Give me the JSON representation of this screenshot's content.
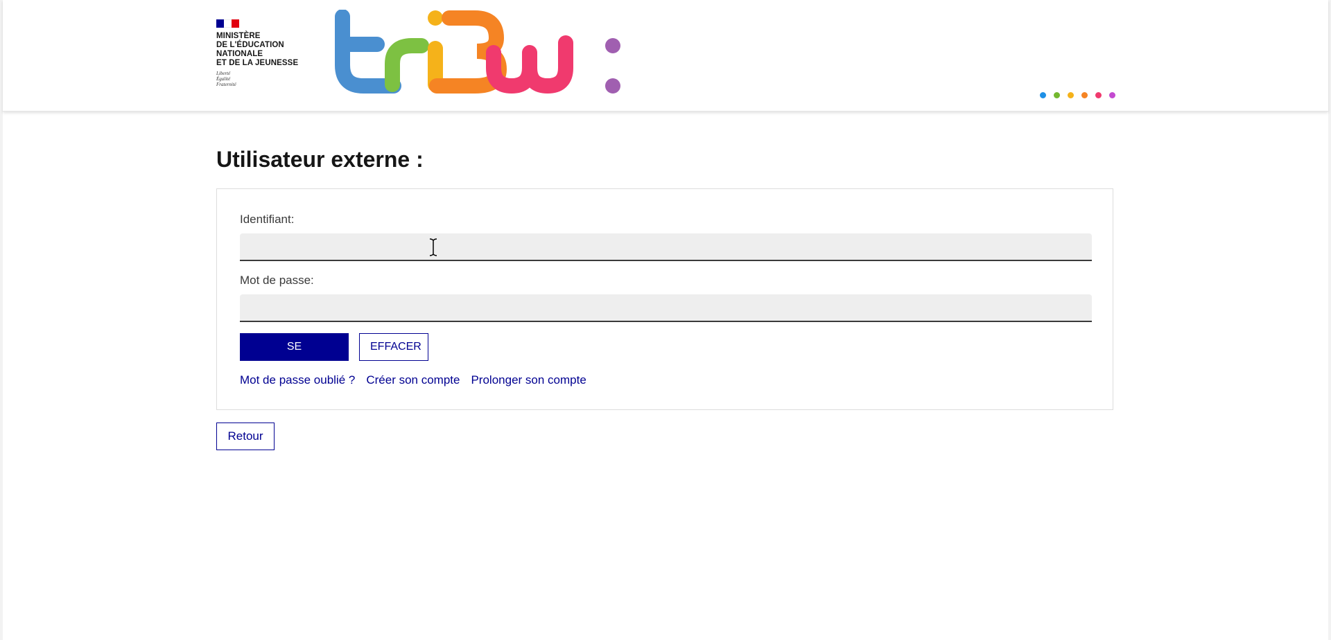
{
  "header": {
    "ministry_lines": "Ministère\nde l'Éducation\nnationale\net de la Jeunesse",
    "ministry_motto": "Liberté\nÉgalité\nFraternité",
    "brand_logo_icon": "tribu-logo",
    "colors": {
      "blue": "#4a8fd0",
      "green": "#7dc142",
      "yellow": "#f5b21a",
      "orange": "#f58424",
      "pink": "#f03a6e",
      "purple": "#a05fb0"
    },
    "dots": [
      "#1e90e6",
      "#74b82f",
      "#f5b21a",
      "#f58424",
      "#f03a6e",
      "#c34ad0"
    ]
  },
  "main": {
    "title": "Utilisateur externe :",
    "form": {
      "username_label": "Identifiant:",
      "username_value": "",
      "password_label": "Mot de passe:",
      "password_value": "",
      "submit_label": "SE CONNECTER",
      "clear_label": "EFFACER",
      "links": {
        "forgot_password": "Mot de passe oublié ?",
        "create_account": "Créer son compte",
        "extend_account": "Prolonger son compte"
      }
    },
    "back_label": "Retour"
  },
  "theme": {
    "primary": "#000091",
    "input_bg": "#eeeeee",
    "text": "#161616"
  }
}
